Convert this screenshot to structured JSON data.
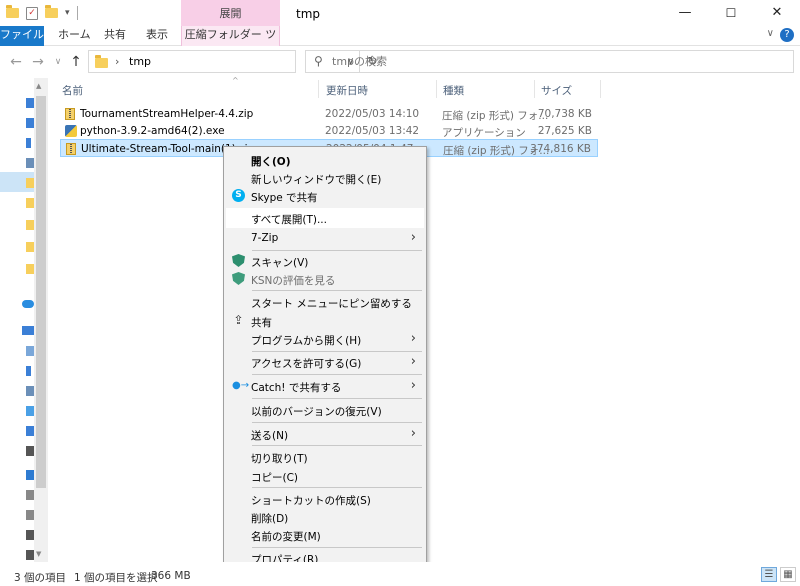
{
  "window": {
    "title": "tmp",
    "contextual_tab_header": "展開",
    "minimize_glyph": "—",
    "maximize_glyph": "☐",
    "close_glyph": "✕"
  },
  "ribbon": {
    "tabs": [
      {
        "label": "ファイル"
      },
      {
        "label": "ホーム"
      },
      {
        "label": "共有"
      },
      {
        "label": "表示"
      },
      {
        "label": "圧縮フォルダー ツール"
      }
    ],
    "help_glyph": "?",
    "collapse_glyph": "∨"
  },
  "nav": {
    "back_glyph": "←",
    "forward_glyph": "→",
    "recent_glyph": "∨",
    "up_glyph": "↑",
    "breadcrumb_separator": "›",
    "path": "tmp",
    "refresh_glyph": "↻",
    "search_placeholder": "tmpの検索"
  },
  "columns": {
    "name": "名前",
    "date": "更新日時",
    "type": "種類",
    "size": "サイズ"
  },
  "files": [
    {
      "name": "TournamentStreamHelper-4.4.zip",
      "date": "2022/05/03 14:10",
      "type": "圧縮 (zip 形式) フォ...",
      "size": "70,738 KB",
      "icon": "zip-icon"
    },
    {
      "name": "python-3.9.2-amd64(2).exe",
      "date": "2022/05/03 13:42",
      "type": "アプリケーション",
      "size": "27,625 KB",
      "icon": "exe-icon"
    },
    {
      "name": "Ultimate-Stream-Tool-main(1).zip",
      "date": "2022/05/04 1:47",
      "type": "圧縮 (zip 形式) フォ...",
      "size": "374,816 KB",
      "icon": "zip-icon"
    }
  ],
  "context_menu": {
    "items": [
      {
        "label": "開く(O)"
      },
      {
        "label": "新しいウィンドウで開く(E)"
      },
      {
        "label": "Skype で共有"
      },
      {
        "label": "すべて展開(T)..."
      },
      {
        "label": "7-Zip"
      },
      {
        "label": "スキャン(V)"
      },
      {
        "label": "KSNの評価を見る"
      },
      {
        "label": "スタート メニューにピン留めする"
      },
      {
        "label": "共有"
      },
      {
        "label": "プログラムから開く(H)"
      },
      {
        "label": "アクセスを許可する(G)"
      },
      {
        "label": "Catch! で共有する"
      },
      {
        "label": "以前のバージョンの復元(V)"
      },
      {
        "label": "送る(N)"
      },
      {
        "label": "切り取り(T)"
      },
      {
        "label": "コピー(C)"
      },
      {
        "label": "ショートカットの作成(S)"
      },
      {
        "label": "削除(D)"
      },
      {
        "label": "名前の変更(M)"
      },
      {
        "label": "プロパティ(R)"
      }
    ],
    "submenu_glyph": "›",
    "skype_glyph": "S",
    "share_glyph": "⇪",
    "catch_glyph": "●→"
  },
  "status": {
    "item_count": "3 個の項目",
    "selection": "1 個の項目を選択",
    "selection_size": "366 MB"
  },
  "colors": {
    "file_tab": "#1979ca",
    "contextual_tab": "#f8cfe7",
    "selection": "#cce8ff",
    "menu_bg": "#f2f2f2"
  }
}
